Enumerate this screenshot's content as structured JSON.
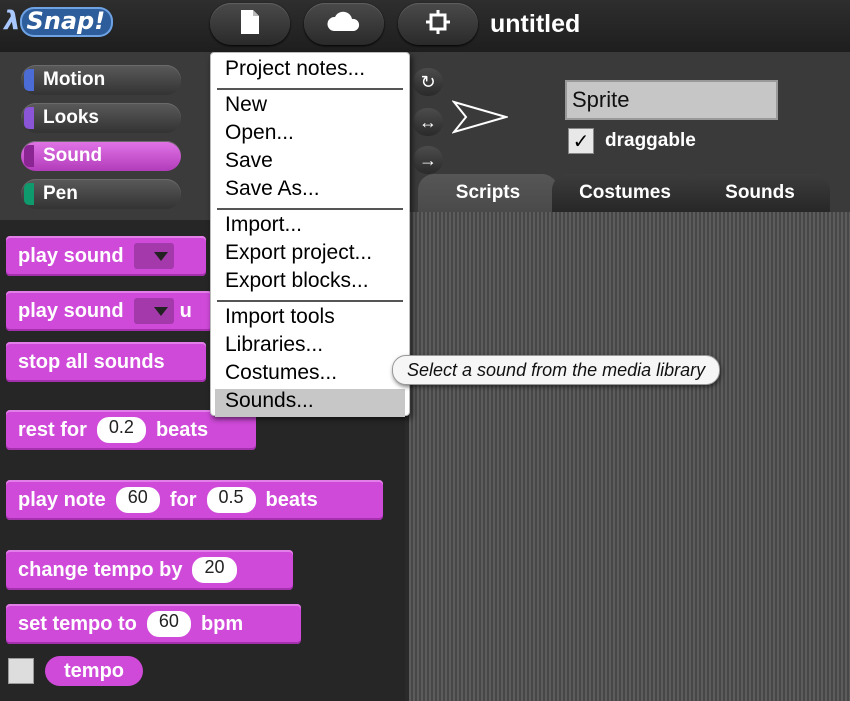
{
  "app": {
    "logo": {
      "lambda": "λ",
      "text": "Snap!"
    },
    "project_title": "untitled"
  },
  "toolbar": {
    "buttons": [
      {
        "icon": "file-icon"
      },
      {
        "icon": "cloud-icon"
      },
      {
        "icon": "gear-icon"
      }
    ]
  },
  "categories": [
    {
      "label": "Motion",
      "color": "#4a6cd4"
    },
    {
      "label": "Looks",
      "color": "#8a55d7"
    },
    {
      "label": "Sound",
      "color": "#cf4ad9",
      "active": true
    },
    {
      "label": "Pen",
      "color": "#0e9a6c"
    }
  ],
  "palette": {
    "blocks": [
      {
        "words": [
          "play sound"
        ],
        "has_dropdown": true
      },
      {
        "words": [
          "play sound"
        ],
        "has_dropdown": true,
        "suffix": "u"
      },
      {
        "words": [
          "stop all sounds"
        ]
      },
      {
        "words": [
          "rest for",
          "beats"
        ],
        "input": "0.2"
      },
      {
        "words": [
          "play note",
          "for",
          "beats"
        ],
        "inputs": [
          "60",
          "0.5"
        ]
      },
      {
        "words": [
          "change tempo by"
        ],
        "input": "20"
      },
      {
        "words": [
          "set tempo to",
          "bpm"
        ],
        "input": "60"
      }
    ],
    "reporter": "tempo"
  },
  "sprite": {
    "name": "Sprite",
    "draggable_label": "draggable",
    "draggable_checked": true,
    "draggable_mark": "✓",
    "rotation_icons": [
      "↻",
      "↔",
      "→"
    ]
  },
  "tabs": [
    {
      "label": "Scripts",
      "active": true
    },
    {
      "label": "Costumes"
    },
    {
      "label": "Sounds"
    }
  ],
  "file_menu": {
    "items": [
      "Project notes...",
      "New",
      "Open...",
      "Save",
      "Save As...",
      "Import...",
      "Export project...",
      "Export blocks...",
      "Import tools",
      "Libraries...",
      "Costumes...",
      "Sounds..."
    ],
    "highlighted": "Sounds..."
  },
  "tooltip": "Select a sound from the media library"
}
